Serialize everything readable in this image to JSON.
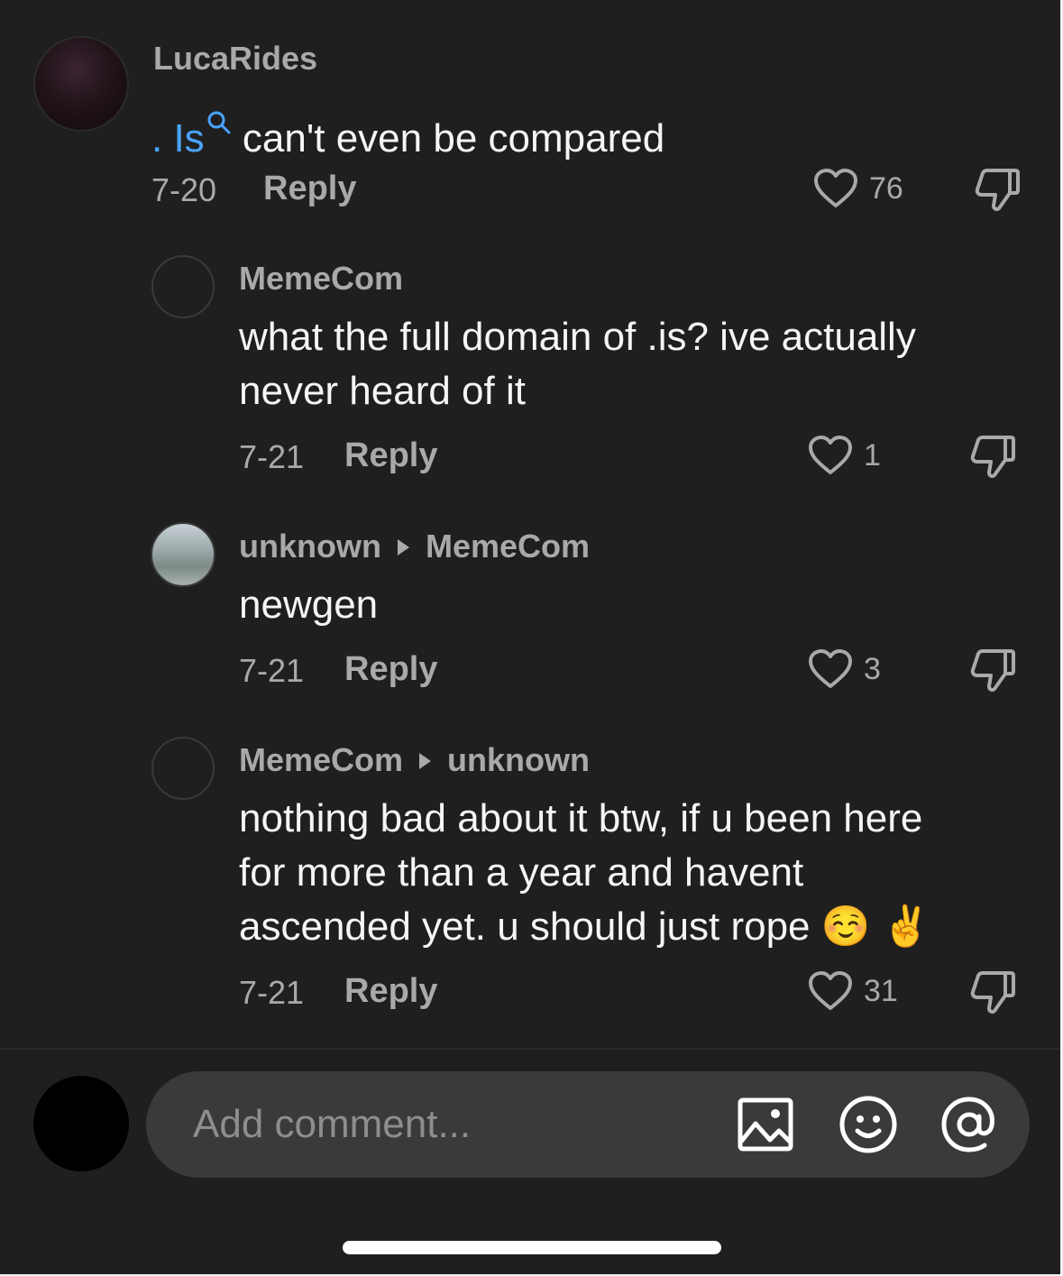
{
  "comments": [
    {
      "author": "LucaRides",
      "reply_to": "",
      "text_prefix": ". Is",
      "text": "can't even be compared",
      "date": "7-20",
      "reply_label": "Reply",
      "likes": "76"
    },
    {
      "author": "MemeCom",
      "reply_to": "",
      "text_line1": "what the full domain of .is? ive actually",
      "text_line2": "never heard of it",
      "date": "7-21",
      "reply_label": "Reply",
      "likes": "1"
    },
    {
      "author": "unknown",
      "reply_to": "MemeCom",
      "text": "newgen",
      "date": "7-21",
      "reply_label": "Reply",
      "likes": "3"
    },
    {
      "author": "MemeCom",
      "reply_to": "unknown",
      "text_line1": "nothing bad about it btw, if u been here",
      "text_line2": "for more than a year and havent",
      "text_line3": "ascended yet. u should just rope ☺️ ✌️",
      "date": "7-21",
      "reply_label": "Reply",
      "likes": "31"
    }
  ],
  "composer": {
    "placeholder": "Add comment...",
    "icons": [
      "image-icon",
      "emoji-icon",
      "mention-icon"
    ]
  },
  "colors": {
    "background": "#1f1f1f",
    "link": "#4aa3ff",
    "muted": "#a9a9a9",
    "text": "#f5f5f5"
  }
}
